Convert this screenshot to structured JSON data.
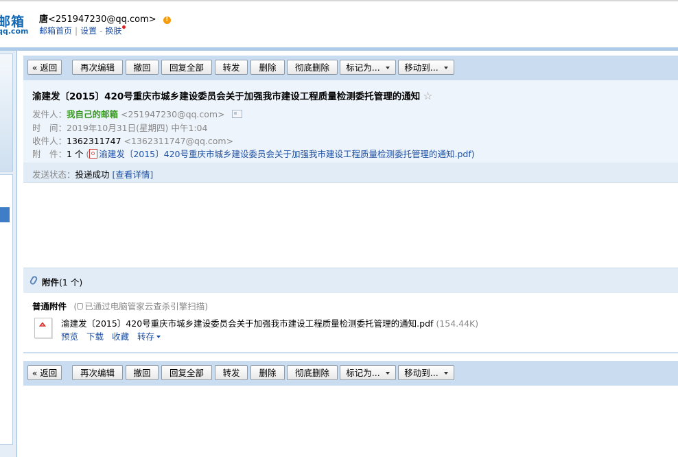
{
  "header": {
    "logo_text": "邮箱",
    "logo_domain": "qq.com",
    "user_name": "唐",
    "user_email": "<251947230@qq.com>",
    "alert_symbol": "!",
    "nav": {
      "home": "邮箱首页",
      "settings": "设置",
      "skin": "换肤"
    }
  },
  "toolbar": {
    "back": "« 返回",
    "edit_again": "再次编辑",
    "recall": "撤回",
    "reply_all": "回复全部",
    "forward": "转发",
    "delete": "删除",
    "delete_permanent": "彻底删除",
    "mark_as": "标记为...",
    "move_to": "移动到..."
  },
  "mail": {
    "subject": "渝建发〔2015〕420号重庆市城乡建设委员会关于加强我市建设工程质量检测委托管理的通知",
    "star": "☆",
    "sender_label": "发件人：",
    "sender_name": "我自己的邮箱",
    "sender_email": "<251947230@qq.com>",
    "time_label": "时　间：",
    "time_value": "2019年10月31日(星期四) 中午1:04",
    "recipient_label": "收件人：",
    "recipient_name": "1362311747",
    "recipient_email": "<1362311747@qq.com>",
    "attach_label": "附　件：",
    "attach_count": "1 个",
    "attach_open": " (",
    "attach_link": "渝建发〔2015〕420号重庆市城乡建设委员会关于加强我市建设工程质量检测委托管理的通知.pdf",
    "attach_close": ")",
    "status_label": "发送状态：",
    "status_value": "投递成功",
    "status_detail": "[查看详情]"
  },
  "attachments": {
    "title": "附件",
    "count": "(1 个)",
    "type_label": "普通附件",
    "scan_text": "已通过电脑管家云查杀引擎扫描)",
    "scan_open": "(",
    "file_name": "渝建发〔2015〕420号重庆市城乡建设委员会关于加强我市建设工程质量检测委托管理的通知.pdf",
    "file_size": "(154.44K)",
    "ops": {
      "preview": "预览",
      "download": "下载",
      "favorite": "收藏",
      "save_to": "转存"
    }
  },
  "colors": {
    "toolbar_bg": "#c9dcf0",
    "link": "#1e50a2",
    "sender_green": "#3b9a24",
    "logo_blue": "#1469b5"
  }
}
